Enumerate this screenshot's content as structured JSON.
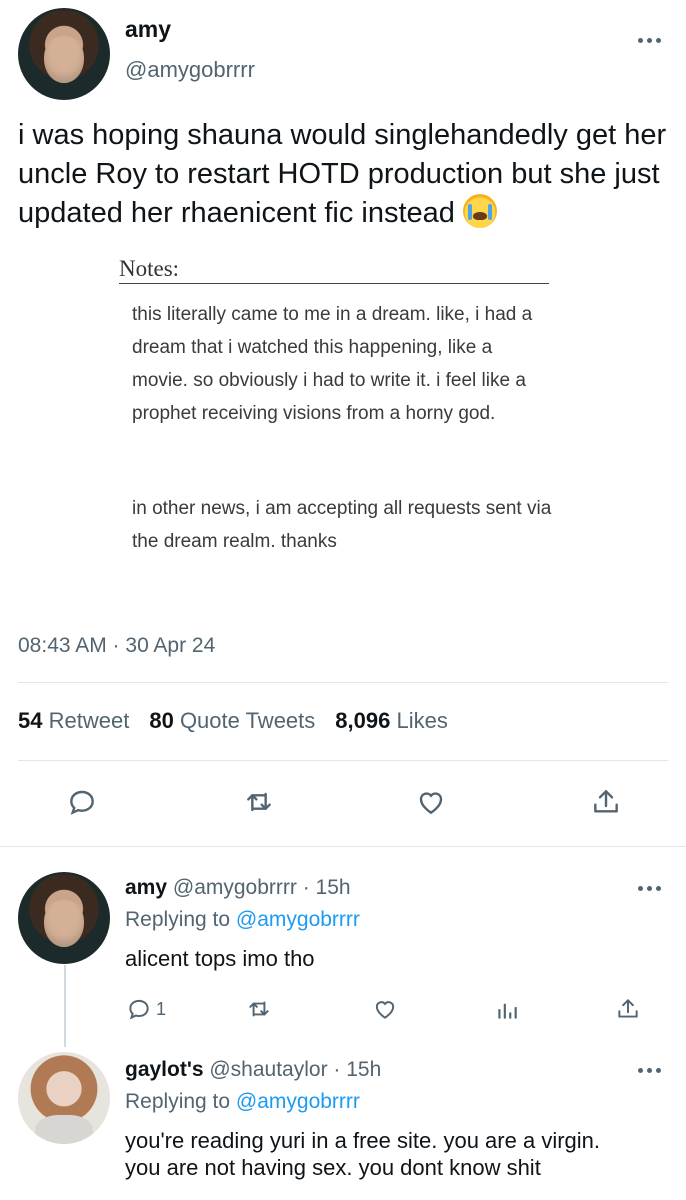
{
  "tweet": {
    "display_name": "amy",
    "handle": "@amygobrrrr",
    "text": "i was hoping shauna would singlehandedly get her uncle Roy to restart HOTD production but she just updated her rhaenicent fic instead",
    "emoji": "loudly-crying-face",
    "image": {
      "title": "Notes:",
      "paragraph_1": "this literally came to me in a dream. like, i had a dream that i watched this happening, like a movie. so obviously i had to write it. i feel like a prophet receiving visions from a horny god.",
      "paragraph_2": "in other news, i am accepting all requests sent via the dream realm. thanks"
    },
    "timestamp": "08:43 AM · 30 Apr 24",
    "stats": {
      "retweets_count": "54",
      "retweets_label": "Retweet",
      "quotes_count": "80",
      "quotes_label": "Quote Tweets",
      "likes_count": "8,096",
      "likes_label": "Likes"
    },
    "actions": [
      "reply-icon",
      "retweet-icon",
      "like-icon",
      "share-icon"
    ]
  },
  "replies": [
    {
      "display_name": "amy",
      "handle_time": "@amygobrrrr · 15h",
      "replying_prefix": "Replying to",
      "replying_to": "@amygobrrrr",
      "text": "alicent tops imo tho",
      "reply_count": "1",
      "actions": [
        "reply-icon",
        "retweet-icon",
        "like-icon",
        "analytics-icon",
        "share-icon"
      ]
    },
    {
      "display_name": "gaylot's",
      "handle_time": "@shautaylor · 15h",
      "replying_prefix": "Replying to",
      "replying_to": "@amygobrrrr",
      "text_line_1": "you're reading yuri in a free site. you are a virgin.",
      "text_line_2": "you are not having sex. you dont know shit"
    }
  ],
  "colors": {
    "text": "#0f1419",
    "secondary": "#536471",
    "accent": "#1d9bf0",
    "divider": "#e1e6ea"
  }
}
